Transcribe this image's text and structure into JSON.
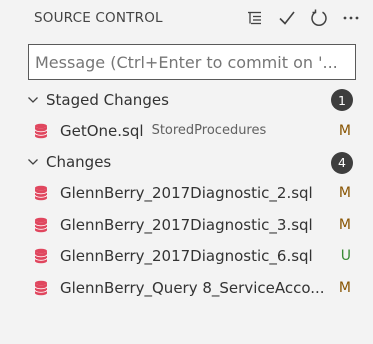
{
  "header": {
    "title": "SOURCE CONTROL",
    "actions": [
      {
        "icon": "view-as-tree-icon"
      },
      {
        "icon": "commit-check-icon"
      },
      {
        "icon": "refresh-icon"
      },
      {
        "icon": "more-actions-icon"
      }
    ]
  },
  "commit_message": {
    "placeholder": "Message (Ctrl+Enter to commit on '...",
    "value": ""
  },
  "groups": [
    {
      "label": "Staged Changes",
      "count": "1",
      "files": [
        {
          "name": "GetOne.sql",
          "dir": "StoredProcedures",
          "status": "M",
          "status_color": "#895503"
        }
      ]
    },
    {
      "label": "Changes",
      "count": "4",
      "files": [
        {
          "name": "GlennBerry_2017Diagnostic_2.sql",
          "dir": "",
          "status": "M",
          "status_color": "#895503"
        },
        {
          "name": "GlennBerry_2017Diagnostic_3.sql",
          "dir": "",
          "status": "M",
          "status_color": "#895503"
        },
        {
          "name": "GlennBerry_2017Diagnostic_6.sql",
          "dir": "",
          "status": "U",
          "status_color": "#388a34"
        },
        {
          "name": "GlennBerry_Query 8_ServiceAcco...",
          "dir": "",
          "status": "M",
          "status_color": "#895503"
        }
      ]
    }
  ],
  "colors": {
    "background": "#f3f3f3",
    "db_icon": "#e0465e",
    "badge_bg": "#3e3e3e"
  }
}
